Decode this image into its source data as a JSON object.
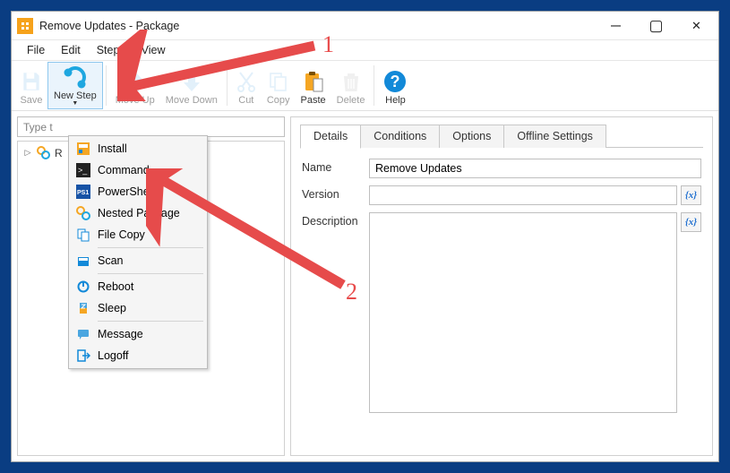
{
  "window_title": "Remove Updates - Package",
  "menubar": [
    "File",
    "Edit",
    "Steps",
    "View"
  ],
  "toolbar": {
    "save": "Save",
    "new_step": "New Step",
    "move_up": "Move Up",
    "move_down": "Move Down",
    "cut": "Cut",
    "copy": "Copy",
    "paste": "Paste",
    "delete": "Delete",
    "help": "Help"
  },
  "left": {
    "filter_placeholder": "Type t",
    "tree_root": "R"
  },
  "dropdown_items": [
    {
      "label": "Install",
      "icon": "install"
    },
    {
      "label": "Command",
      "icon": "command"
    },
    {
      "label": "PowerShell",
      "icon": "powershell"
    },
    {
      "label": "Nested Package",
      "icon": "nested"
    },
    {
      "label": "File Copy",
      "icon": "filecopy"
    },
    {
      "sep": true
    },
    {
      "label": "Scan",
      "icon": "scan"
    },
    {
      "sep": true
    },
    {
      "label": "Reboot",
      "icon": "reboot"
    },
    {
      "label": "Sleep",
      "icon": "sleep"
    },
    {
      "sep": true
    },
    {
      "label": "Message",
      "icon": "message"
    },
    {
      "label": "Logoff",
      "icon": "logoff"
    }
  ],
  "tabs": [
    "Details",
    "Conditions",
    "Options",
    "Offline Settings"
  ],
  "active_tab": "Details",
  "form": {
    "name_label": "Name",
    "name_value": "Remove Updates",
    "version_label": "Version",
    "version_value": "",
    "description_label": "Description",
    "description_value": ""
  },
  "annotations": {
    "n1": "1",
    "n2": "2"
  }
}
